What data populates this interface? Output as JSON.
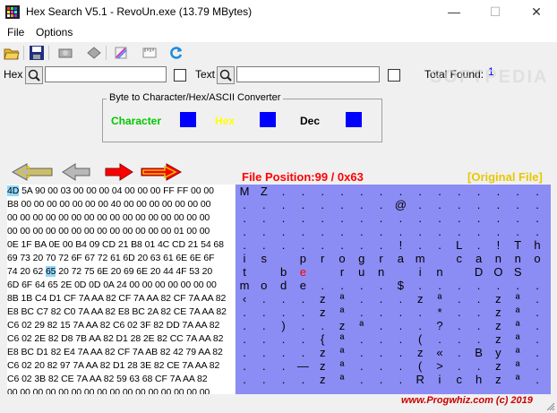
{
  "window": {
    "title": "Hex Search V5.1 - RevoUn.exe (13.79 MBytes)",
    "minimize": "—",
    "maximize": "☐",
    "close": "✕"
  },
  "menu": [
    "File",
    "Options"
  ],
  "toolbar": [
    "open-folder-icon",
    "save-icon",
    "print-preview-icon",
    "print-icon",
    "palette-icon",
    "ruler-icon",
    "refresh-icon"
  ],
  "search": {
    "hex_label": "Hex",
    "hex_value": "",
    "text_label": "Text",
    "text_value": "",
    "total_found_label": "Total Found:",
    "total_found_value": "1"
  },
  "converter": {
    "title": "Byte to Character/Hex/ASCII Converter",
    "character_label": "Character",
    "hex_label": "Hex",
    "dec_label": "Dec",
    "character_color": "#00c800",
    "hex_color": "#ffff00",
    "dec_color": "#000000",
    "box_color": "#0000ff"
  },
  "nav": [
    "first-icon",
    "previous-icon",
    "next-icon",
    "last-icon"
  ],
  "file_position": "File Position:99 / 0x63",
  "original_file": "[Original File]",
  "hex_rows": [
    "4D 5A 90 00 03 00 00 00 04 00 00 00 FF FF 00 00",
    "B8 00 00 00 00 00 00 00 40 00 00 00 00 00 00 00",
    "00 00 00 00 00 00 00 00 00 00 00 00 00 00 00 00",
    "00 00 00 00 00 00 00 00 00 00 00 00 00 01 00 00",
    "0E 1F BA 0E 00 B4 09 CD 21 B8 01 4C CD 21 54 68",
    "69 73 20 70 72 6F 67 72 61 6D 20 63 61 6E 6E 6F",
    "74 20 62 65 20 72 75 6E 20 69 6E 20 44 4F 53 20",
    "6D 6F 64 65 2E 0D 0D 0A 24 00 00 00 00 00 00 00",
    "8B 1B C4 D1 CF 7A AA 82 CF 7A AA 82 CF 7A AA 82",
    "E8 BC C7 82 C0 7A AA 82 E8 BC 2A 82 CE 7A AA 82",
    "C6 02 29 82 15 7A AA 82 C6 02 3F 82 DD 7A AA 82",
    "C6 02 2E 82 D8 7B AA 82 D1 28 2E 82 CC 7A AA 82",
    "E8 BC D1 82 E4 7A AA 82 CF 7A AB 82 42 79 AA 82",
    "C6 02 20 82 97 7A AA 82 D1 28 3E 82 CE 7A AA 82",
    "C6 02 3B 82 CE 7A AA 82 59 63 68 CF 7A AA 82",
    "00 00 00 00 00 00 00 00 00 00 00 00 00 00 00 00"
  ],
  "ascii_rows": [
    [
      "M",
      "Z",
      ".",
      ".",
      ".",
      ".",
      ".",
      ".",
      ".",
      ".",
      ".",
      ".",
      ".",
      ".",
      ".",
      "."
    ],
    [
      ".",
      ".",
      ".",
      ".",
      ".",
      ".",
      ".",
      ".",
      "@",
      ".",
      ".",
      ".",
      ".",
      ".",
      ".",
      "."
    ],
    [
      ".",
      ".",
      ".",
      ".",
      ".",
      ".",
      ".",
      ".",
      ".",
      ".",
      ".",
      ".",
      ".",
      ".",
      ".",
      "."
    ],
    [
      ".",
      ".",
      ".",
      ".",
      ".",
      ".",
      ".",
      ".",
      ".",
      ".",
      ".",
      ".",
      ".",
      ".",
      ".",
      "."
    ],
    [
      ".",
      ".",
      ".",
      ".",
      ".",
      ".",
      ".",
      ".",
      "!",
      ".",
      ".",
      "L",
      ".",
      "!",
      "T",
      "h"
    ],
    [
      "i",
      "s",
      " ",
      "p",
      "r",
      "o",
      "g",
      "r",
      "a",
      "m",
      " ",
      "c",
      "a",
      "n",
      "n",
      "o"
    ],
    [
      "t",
      " ",
      "b",
      "e",
      " ",
      "r",
      "u",
      "n",
      " ",
      "i",
      "n",
      " ",
      "D",
      "O",
      "S",
      " "
    ],
    [
      "m",
      "o",
      "d",
      "e",
      ".",
      ".",
      ".",
      ".",
      "$",
      ".",
      ".",
      ".",
      ".",
      ".",
      ".",
      "."
    ],
    [
      "‹",
      ".",
      ".",
      ".",
      "z",
      "ª",
      ".",
      ".",
      ".",
      "z",
      "ª",
      ".",
      ".",
      "z",
      "ª",
      "."
    ],
    [
      ".",
      ".",
      ".",
      ".",
      "z",
      "ª",
      ".",
      ".",
      ".",
      ".",
      "*",
      ".",
      ".",
      "z",
      "ª",
      "."
    ],
    [
      ".",
      ".",
      ")",
      ".",
      ".",
      "z",
      "ª",
      ".",
      ".",
      ".",
      "?",
      ".",
      ".",
      "z",
      "ª",
      "."
    ],
    [
      ".",
      ".",
      ".",
      ".",
      "{",
      "ª",
      ".",
      ".",
      ".",
      "(",
      ".",
      ".",
      ".",
      "z",
      "ª",
      "."
    ],
    [
      ".",
      ".",
      ".",
      ".",
      "z",
      "ª",
      ".",
      ".",
      ".",
      "z",
      "«",
      ".",
      "B",
      "y",
      "ª",
      "."
    ],
    [
      ".",
      ".",
      ".",
      "—",
      "z",
      "ª",
      ".",
      ".",
      ".",
      "(",
      ">",
      ".",
      ".",
      "z",
      "ª",
      "."
    ],
    [
      ".",
      ".",
      ".",
      ".",
      "z",
      "ª",
      ".",
      ".",
      ".",
      "R",
      "i",
      "c",
      "h",
      "z",
      "ª",
      "."
    ],
    [
      ".",
      ".",
      ".",
      ".",
      ".",
      ".",
      ".",
      ".",
      ".",
      ".",
      ".",
      ".",
      ".",
      ".",
      ".",
      "."
    ]
  ],
  "footer": "www.Progwhiz.com (c) 2019",
  "watermark": "SOFTPEDIA"
}
